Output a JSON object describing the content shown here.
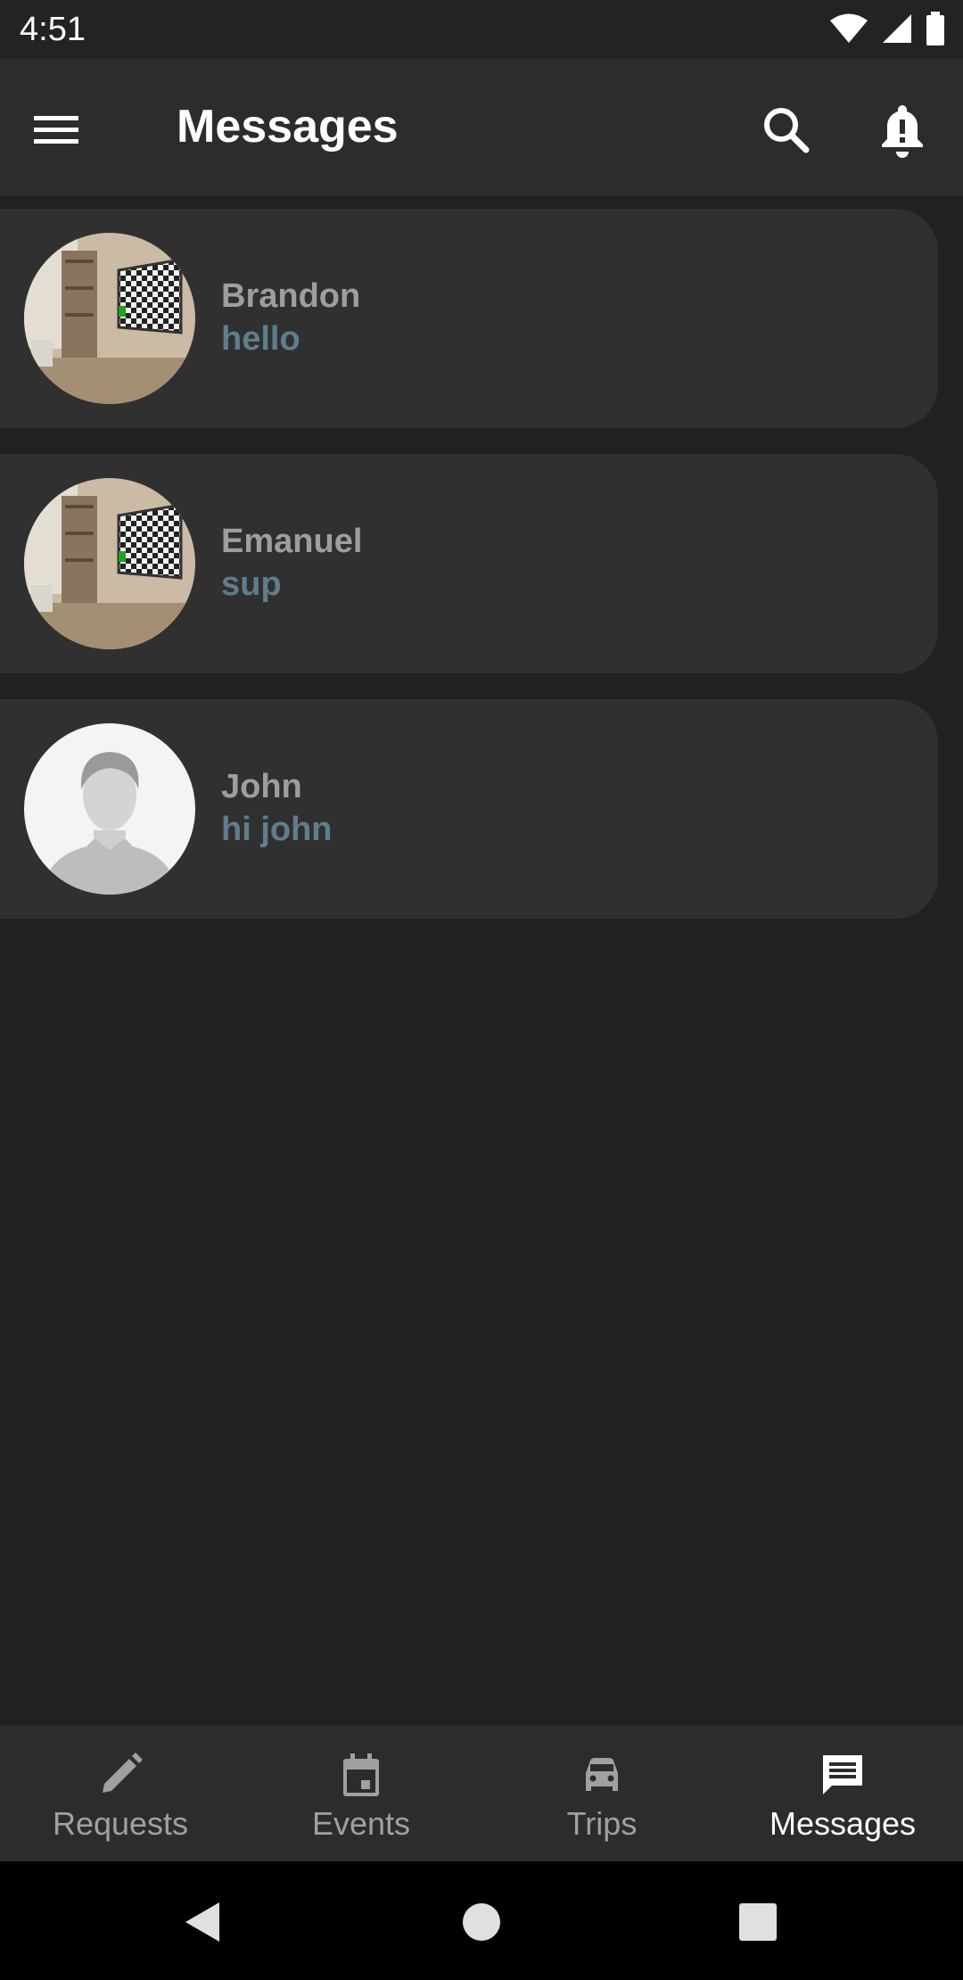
{
  "status_bar": {
    "time": "4:51"
  },
  "app_bar": {
    "title": "Messages"
  },
  "conversations": [
    {
      "name": "Brandon",
      "preview": "hello",
      "avatar": "room-photo"
    },
    {
      "name": "Emanuel",
      "preview": "sup",
      "avatar": "room-photo"
    },
    {
      "name": "John",
      "preview": "hi john",
      "avatar": "default-person"
    }
  ],
  "bottom_nav": {
    "items": [
      {
        "label": "Requests",
        "icon": "pencil-icon"
      },
      {
        "label": "Events",
        "icon": "calendar-icon"
      },
      {
        "label": "Trips",
        "icon": "car-icon"
      },
      {
        "label": "Messages",
        "icon": "message-icon",
        "active": true
      }
    ]
  },
  "colors": {
    "background": "#212121",
    "app_bar": "#2c2c2c",
    "card": "#303030",
    "name_text": "#9e9e9e",
    "preview_text": "#607d8b"
  }
}
